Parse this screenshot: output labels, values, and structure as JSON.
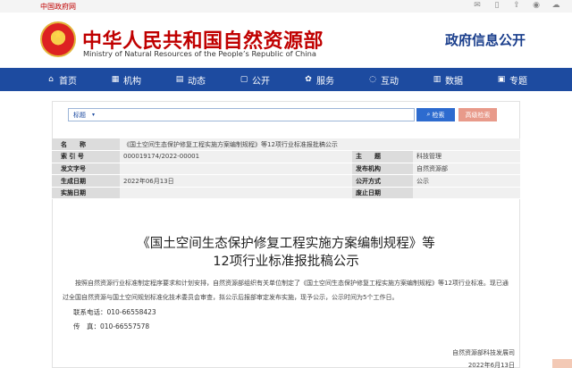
{
  "topbar": {
    "gov_link": "中国政府网",
    "icons": [
      "mail-icon",
      "mobile-icon",
      "share-icon",
      "weibo-icon",
      "wechat-icon"
    ]
  },
  "header": {
    "title_cn": "中华人民共和国自然资源部",
    "title_en": "Ministry of Natural Resources of the People’s Republic of China",
    "gov_info": "政府信息公开"
  },
  "nav": [
    {
      "label": "首页",
      "icon": "home-icon"
    },
    {
      "label": "机构",
      "icon": "building-icon"
    },
    {
      "label": "动态",
      "icon": "news-icon"
    },
    {
      "label": "公开",
      "icon": "doc-icon"
    },
    {
      "label": "服务",
      "icon": "service-icon"
    },
    {
      "label": "互动",
      "icon": "chat-icon"
    },
    {
      "label": "数据",
      "icon": "chart-icon"
    },
    {
      "label": "专题",
      "icon": "topic-icon"
    }
  ],
  "search": {
    "field_label": "标题",
    "search_button": "检索",
    "advanced_button": "高级检索"
  },
  "meta": {
    "rows": [
      {
        "k1": "名　　称",
        "v1": "《国土空间生态保护修复工程实施方案编制规程》等12项行业标准报批稿公示",
        "k2": "",
        "v2": ""
      },
      {
        "k1": "索 引 号",
        "v1": "000019174/2022-00001",
        "k2": "主　　题",
        "v2": "科技管理"
      },
      {
        "k1": "发文字号",
        "v1": "",
        "k2": "发布机构",
        "v2": "自然资源部"
      },
      {
        "k1": "生成日期",
        "v1": "2022年06月13日",
        "k2": "公开方式",
        "v2": "公示"
      },
      {
        "k1": "实施日期",
        "v1": "",
        "k2": "废止日期",
        "v2": ""
      }
    ]
  },
  "article": {
    "title_line1": "《国土空间生态保护修复工程实施方案编制规程》等",
    "title_line2": "12项行业标准报批稿公示",
    "body": "按照自然资源行业标准制定程序要求和计划安排，自然资源部组织有关单位制定了《国土空间生态保护修复工程实施方案编制规程》等12项行业标准。现已通过全国自然资源与国土空间规划标准化技术委员会审查，拟公示后报部审定发布实施，现予公示，公示时间为5个工作日。",
    "phone": "联系电话：010-66558423",
    "fax": "传　真：010-66557578",
    "signature": "自然资源部科技发展司",
    "date": "2022年6月13日"
  }
}
